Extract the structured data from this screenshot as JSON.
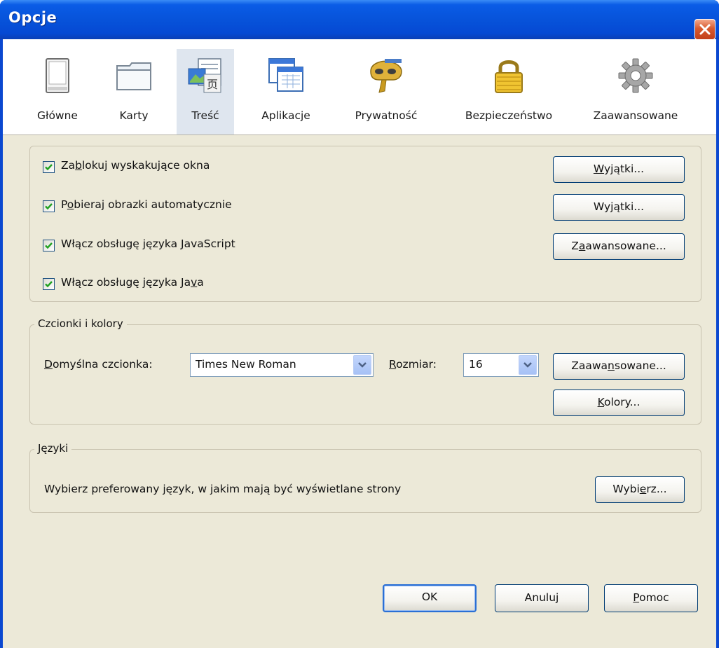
{
  "window": {
    "title": "Opcje"
  },
  "toolbar": {
    "items": [
      {
        "label": "Główne",
        "icon": "window-icon"
      },
      {
        "label": "Karty",
        "icon": "tabs-icon"
      },
      {
        "label": "Treść",
        "icon": "content-icon",
        "selected": true
      },
      {
        "label": "Aplikacje",
        "icon": "applications-icon"
      },
      {
        "label": "Prywatność",
        "icon": "privacy-mask-icon"
      },
      {
        "label": "Bezpieczeństwo",
        "icon": "padlock-icon"
      },
      {
        "label": "Zaawansowane",
        "icon": "gear-icon"
      }
    ]
  },
  "content_group": {
    "checkboxes": [
      {
        "pre": "Za",
        "key": "b",
        "post": "lokuj wyskakujące okna",
        "checked": true
      },
      {
        "pre": "P",
        "key": "o",
        "post": "bieraj obrazki automatycznie",
        "checked": true
      },
      {
        "pre": "Włącz obsługę języka ",
        "key": "J",
        "post": "avaScript",
        "checked": true
      },
      {
        "pre": "Włącz obsługę języka Ja",
        "key": "v",
        "post": "a",
        "checked": true
      }
    ],
    "buttons": [
      {
        "pre": "",
        "key": "W",
        "post": "yjątki..."
      },
      {
        "pre": "Wy",
        "key": "j",
        "post": "ątki..."
      },
      {
        "pre": "Z",
        "key": "a",
        "post": "awansowane..."
      }
    ]
  },
  "fonts_group": {
    "legend": "Czcionki i kolory",
    "default_font_label": {
      "pre": "",
      "key": "D",
      "post": "omyślna czcionka:"
    },
    "default_font_value": "Times New Roman",
    "size_label": {
      "pre": "",
      "key": "R",
      "post": "ozmiar:"
    },
    "size_value": "16",
    "advanced_button": {
      "pre": "Zaawa",
      "key": "n",
      "post": "sowane..."
    },
    "colors_button": {
      "pre": "",
      "key": "K",
      "post": "olory..."
    }
  },
  "languages_group": {
    "legend": "Języki",
    "description": "Wybierz preferowany język, w jakim mają być wyświetlane strony",
    "choose_button": {
      "pre": "Wybi",
      "key": "e",
      "post": "rz..."
    }
  },
  "footer": {
    "ok": "OK",
    "cancel": "Anuluj",
    "help": {
      "pre": "",
      "key": "P",
      "post": "omoc"
    }
  },
  "colors": {
    "titlebar": "#0753da",
    "dialog_bg": "#ece9d8",
    "selected_tab": "#dfe6ef",
    "checkmark": "#21a121",
    "close_button": "#d85a2e"
  }
}
